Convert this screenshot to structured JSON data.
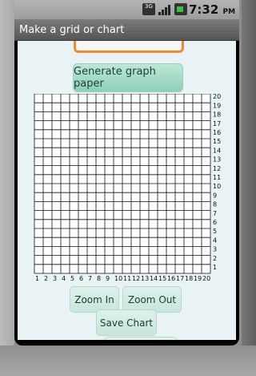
{
  "status_bar": {
    "network_label": "3G",
    "time": "7:32",
    "ampm": "PM",
    "icons": [
      "3g-icon",
      "signal-icon",
      "battery-icon"
    ]
  },
  "app": {
    "title": "Make a grid or chart"
  },
  "buttons": {
    "generate_label": "Generate graph paper",
    "zoom_in_label": "Zoom In",
    "zoom_out_label": "Zoom Out",
    "save_label": "Save Chart"
  },
  "chart_data": {
    "type": "grid",
    "columns": 20,
    "rows": 20,
    "x_tick_labels": [
      "1",
      "2",
      "3",
      "4",
      "5",
      "6",
      "7",
      "8",
      "9",
      "10",
      "11",
      "12",
      "13",
      "14",
      "15",
      "16",
      "17",
      "18",
      "19",
      "20"
    ],
    "y_tick_labels": [
      "1",
      "2",
      "3",
      "4",
      "5",
      "6",
      "7",
      "8",
      "9",
      "10",
      "11",
      "12",
      "13",
      "14",
      "15",
      "16",
      "17",
      "18",
      "19",
      "20"
    ],
    "grid": true,
    "colors": {
      "grid_lines": "#111111",
      "background": "#ffffff"
    }
  },
  "colors": {
    "accent_orange": "#f08a2c",
    "button_green": "#8dd0b8",
    "content_bg": "#e9f3f6"
  }
}
